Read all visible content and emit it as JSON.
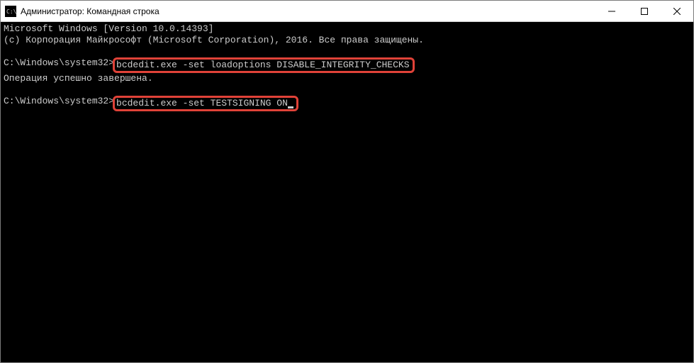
{
  "window": {
    "title": "Администратор: Командная строка"
  },
  "console": {
    "banner_line1": "Microsoft Windows [Version 10.0.14393]",
    "banner_line2": "(c) Корпорация Майкрософт (Microsoft Corporation), 2016. Все права защищены.",
    "prompt1_path": "C:\\Windows\\system32>",
    "command1": "bcdedit.exe -set loadoptions DISABLE_INTEGRITY_CHECKS",
    "result1": "Операция успешно завершена.",
    "prompt2_path": "C:\\Windows\\system32>",
    "command2": "bcdedit.exe -set TESTSIGNING ON"
  },
  "colors": {
    "highlight_border": "#e04238",
    "console_bg": "#000000",
    "console_fg": "#cccccc"
  }
}
